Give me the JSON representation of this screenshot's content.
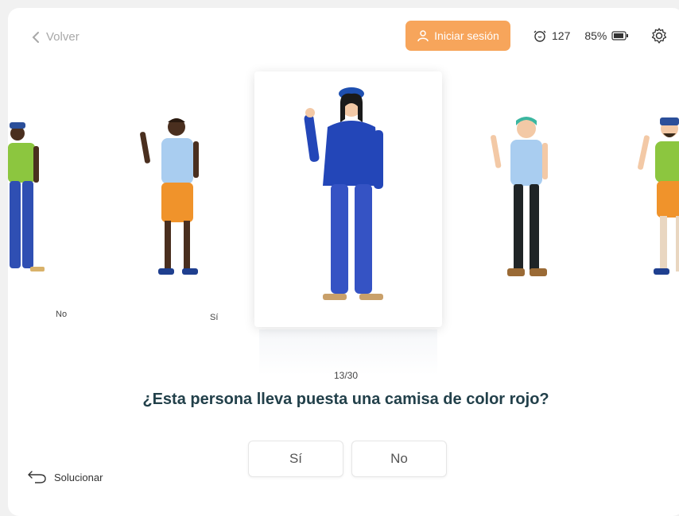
{
  "header": {
    "back_label": "Volver",
    "login_label": "Iniciar sesión",
    "login_color": "#f7a55b",
    "streak_count": "127",
    "battery_percent": "85%"
  },
  "cards": [
    {
      "label": "No",
      "figure": "person-green-shirt-blue-pants"
    },
    {
      "label": "Sí",
      "figure": "person-light-blue-shirt-orange-shorts"
    },
    {
      "label": "",
      "figure": "person-blue-hoodie-blue-pants"
    },
    {
      "label": "",
      "figure": "person-light-blue-shirt-black-pants"
    },
    {
      "label": "",
      "figure": "person-green-shirt-orange-shorts"
    }
  ],
  "quiz": {
    "counter": "13/30",
    "question": "¿Esta persona lleva puesta una camisa de color rojo?",
    "yes_label": "Sí",
    "no_label": "No"
  },
  "footer": {
    "solve_label": "Solucionar"
  }
}
